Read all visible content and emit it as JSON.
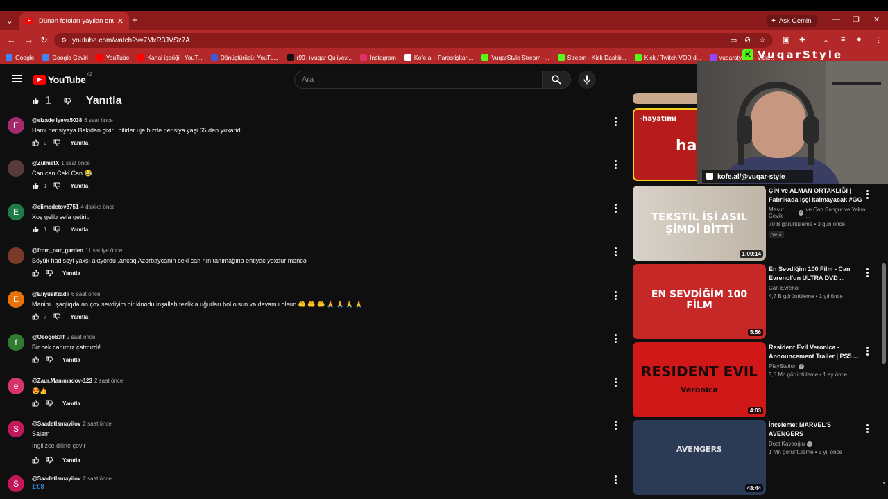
{
  "browser": {
    "tab_title": "Dünən fotoları yayılan onun du",
    "ask_gemini": "Ask Gemini",
    "url": "youtube.com/watch?v=7MxR3JVSz7A",
    "bookmarks": [
      {
        "label": "Google",
        "color": "#4285f4"
      },
      {
        "label": "Google Çeviri",
        "color": "#4285f4"
      },
      {
        "label": "YouTube",
        "color": "#ff0000"
      },
      {
        "label": "Kanal içeriği - YouT...",
        "color": "#ff0000"
      },
      {
        "label": "Dönüştürücü: YouTu...",
        "color": "#3b5bdb"
      },
      {
        "label": "(99+)Vuqar Quliyev...",
        "color": "#111111"
      },
      {
        "label": "Instagram",
        "color": "#e1306c"
      },
      {
        "label": "Kofe.al - Parastişkarl...",
        "color": "#ffffff"
      },
      {
        "label": "VuqarStyle Stream -...",
        "color": "#53fc18"
      },
      {
        "label": "Stream - Kick Dashb...",
        "color": "#53fc18"
      },
      {
        "label": "Kick / Twitch VOD d...",
        "color": "#53fc18"
      },
      {
        "label": "vuqarstyletw - Vide...",
        "color": "#9146ff"
      }
    ]
  },
  "youtube": {
    "logo_text": "YouTube",
    "country_code": "AZ",
    "search_placeholder": "Ara"
  },
  "comments": {
    "top_like_count": "1",
    "reply_label": "Yanıtla",
    "items": [
      {
        "user": "@elzadeliyeva5038",
        "time": "6 saat önce",
        "text": "Hami pensiyaya Bakidan çixir...bilirler uje bizde pensiya yaşi 65 den yuxaridi",
        "likes": "2",
        "avatar_letter": "E",
        "avatar_color": "#a52a6b"
      },
      {
        "user": "@ZulmetX",
        "time": "1 saat önce",
        "text": "Can can Ceki Can 😂",
        "likes": "1",
        "avatar_letter": "",
        "avatar_color": "#5a3a3a"
      },
      {
        "user": "@elimedetov8751",
        "time": "4 dakika önce",
        "text": "Xoş gelib sefa  getirib",
        "likes": "1",
        "avatar_letter": "E",
        "avatar_color": "#1f7a4a"
      },
      {
        "user": "@from_our_garden",
        "time": "11 saniye önce",
        "text": "Böyük hadisəyi yaxşı aktyordu ,ancaq  Azərbaycanın ceki can nın tanımağına ehtiyac yoxdur məncə",
        "likes": "",
        "avatar_letter": "",
        "avatar_color": "#7a3a2a"
      },
      {
        "user": "@Eliyusifzadli",
        "time": "6 saat önce",
        "text": "Mənim uşaqlıqda ən çox sevdiyim bir kinodu inşallah tezliklə uğurları bol olsun və davamlı olsun 🤲 🤲 🤲 🙏 🙏 🙏 🙏",
        "likes": "7",
        "avatar_letter": "E",
        "avatar_color": "#e8710a"
      },
      {
        "user": "@Oeogo63lf",
        "time": "2 saat önce",
        "text": "Bir cek canımız çatmırdı!",
        "likes": "",
        "avatar_letter": "f",
        "avatar_color": "#2e7d32"
      },
      {
        "user": "@Zaur.Mammadov-123",
        "time": "2 saat önce",
        "text": "😍👍",
        "likes": "",
        "avatar_letter": "e",
        "avatar_color": "#d6336c"
      },
      {
        "user": "@SaadetIsmayilov",
        "time": "2 saat önce",
        "text": "Salam",
        "text2": "İngilizce diline çevir",
        "likes": "",
        "avatar_letter": "S",
        "avatar_color": "#c2185b"
      },
      {
        "user": "@SaadetIsmayilov",
        "time": "2 saat önce",
        "timestamp_link": "1:08",
        "avatar_letter": "S",
        "avatar_color": "#c2185b"
      }
    ]
  },
  "recommendations": [
    {
      "title": "ÇİN ve ALMAN ORTAKLIĞI | Fabrikada işçi kalmayacak #GG",
      "channel": "Mesut Çevik",
      "channel_extra": "ve Can Sungur ve Yakın ...",
      "verified": true,
      "stats": "70 B görüntüleme • 3 gün önce",
      "badge": "Yeni",
      "duration": "1:09:14",
      "thumb_text": "TEKSTİL İŞİ ASIL ŞİMDİ BİTTİ"
    },
    {
      "title": "En Sevdiğim 100 Film - Can Evrenol'un ULTRA DVD ...",
      "channel": "Can Evrenol",
      "verified": false,
      "stats": "4,7 B görüntüleme • 1 yıl önce",
      "duration": "5:56",
      "thumb_text": "EN SEVDİĞİM 100 FİLM"
    },
    {
      "title": "Resident Evil Veronica - Announcement Trailer | PS5 ...",
      "channel": "PlayStation",
      "verified": true,
      "stats": "5,5 Mn görüntüleme • 1 ay önce",
      "duration": "4:03",
      "thumb_text": "RESIDENT EVIL",
      "thumb_sub": "Veronica"
    },
    {
      "title": "İnceleme: MARVEL'S AVENGERS",
      "channel": "Dost Kayaoğlu",
      "verified": true,
      "stats": "1 Mn görüntüleme • 5 yıl önce",
      "duration": "48:44",
      "thumb_text": "AVENGERS"
    }
  ],
  "overlay": {
    "brand": "VuqarStyle",
    "kofe": "kofe.al/@vuqar-style",
    "partial_thumb_text": "ha",
    "partial_thumb_text2": "-hayatımı"
  }
}
